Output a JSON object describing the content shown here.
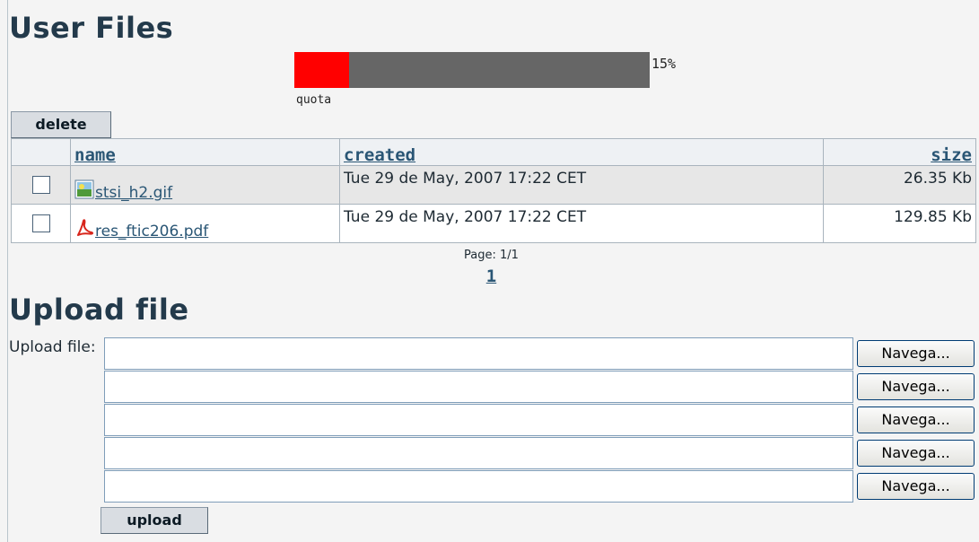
{
  "titles": {
    "user_files": "User Files",
    "upload_file": "Upload file"
  },
  "quota": {
    "percent_label": "15%",
    "value": 0.155,
    "label": "quota",
    "used_color": "#ff0000",
    "free_color": "#666666"
  },
  "buttons": {
    "delete": "delete",
    "upload": "upload",
    "browse": "Navega..."
  },
  "table": {
    "columns": [
      "name",
      "created",
      "size"
    ],
    "rows": [
      {
        "name": "stsi_h2.gif",
        "icon": "image-file-icon",
        "created": "Tue 29 de May, 2007 17:22 CET",
        "size": "26.35 Kb"
      },
      {
        "name": "res_ftic206.pdf",
        "icon": "pdf-file-icon",
        "created": "Tue 29 de May, 2007 17:22 CET",
        "size": "129.85 Kb"
      }
    ]
  },
  "pagination": {
    "label": "Page: 1/1",
    "pages": [
      "1"
    ]
  },
  "upload": {
    "label": "Upload file:",
    "fields": 5
  },
  "colors": {
    "heading": "#233a4b",
    "link": "#2a5675",
    "page_bg": "#f4f4f4"
  }
}
